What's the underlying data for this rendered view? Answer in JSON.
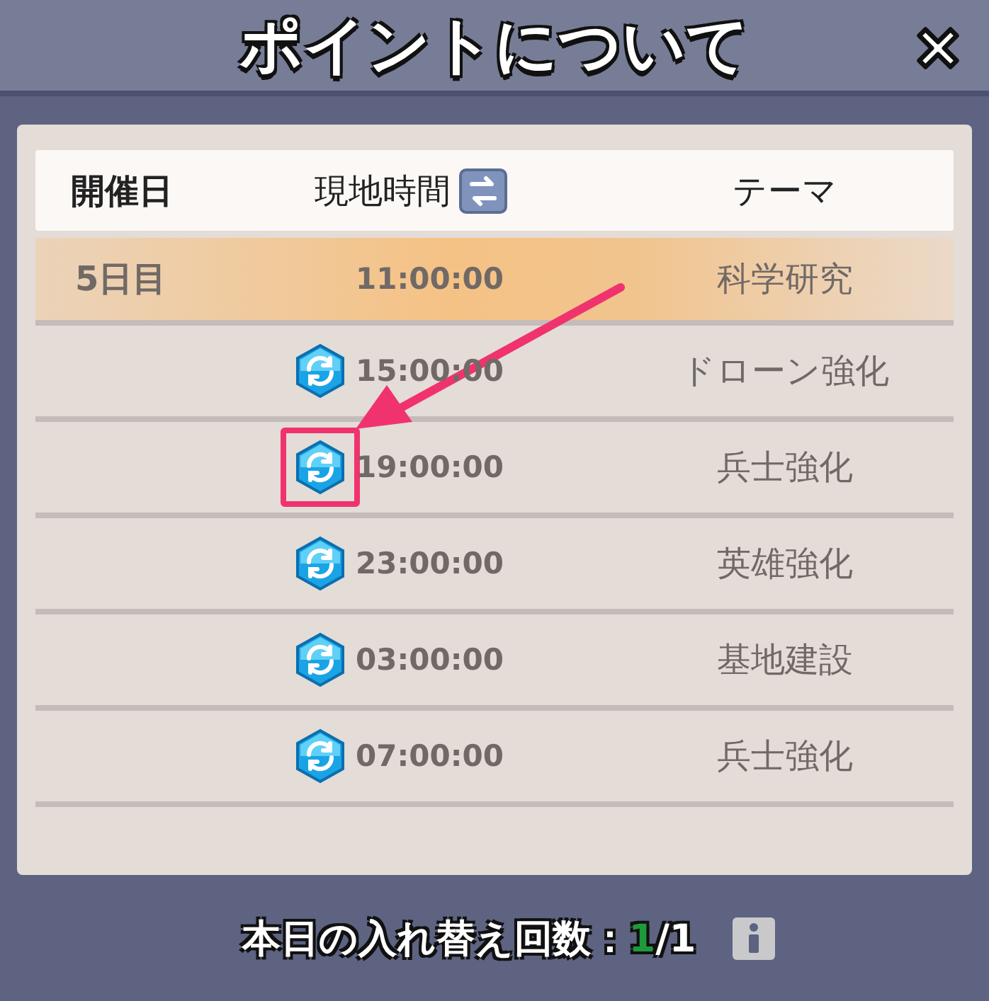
{
  "window": {
    "title": "ポイントについて"
  },
  "table": {
    "columns": [
      {
        "label": "開催日",
        "kind": "day"
      },
      {
        "label": "現地時間",
        "kind": "time"
      },
      {
        "label": "テーマ",
        "kind": "theme"
      }
    ],
    "rows": [
      {
        "day": "5日目",
        "time": "11:00:00",
        "theme": "科学研究",
        "highlighted": true,
        "swappable": false,
        "marked": false
      },
      {
        "time": "15:00:00",
        "theme": "ドローン強化",
        "highlighted": false,
        "swappable": true,
        "marked": false
      },
      {
        "time": "19:00:00",
        "theme": "兵士強化",
        "highlighted": false,
        "swappable": true,
        "marked": true
      },
      {
        "time": "23:00:00",
        "theme": "英雄強化",
        "highlighted": false,
        "swappable": true,
        "marked": false
      },
      {
        "time": "03:00:00",
        "theme": "基地建設",
        "highlighted": false,
        "swappable": true,
        "marked": false
      },
      {
        "time": "07:00:00",
        "theme": "兵士強化",
        "highlighted": false,
        "swappable": true,
        "marked": false
      }
    ]
  },
  "footer": {
    "label": "本日の入れ替え回数：",
    "used": "1",
    "total": "/1"
  }
}
